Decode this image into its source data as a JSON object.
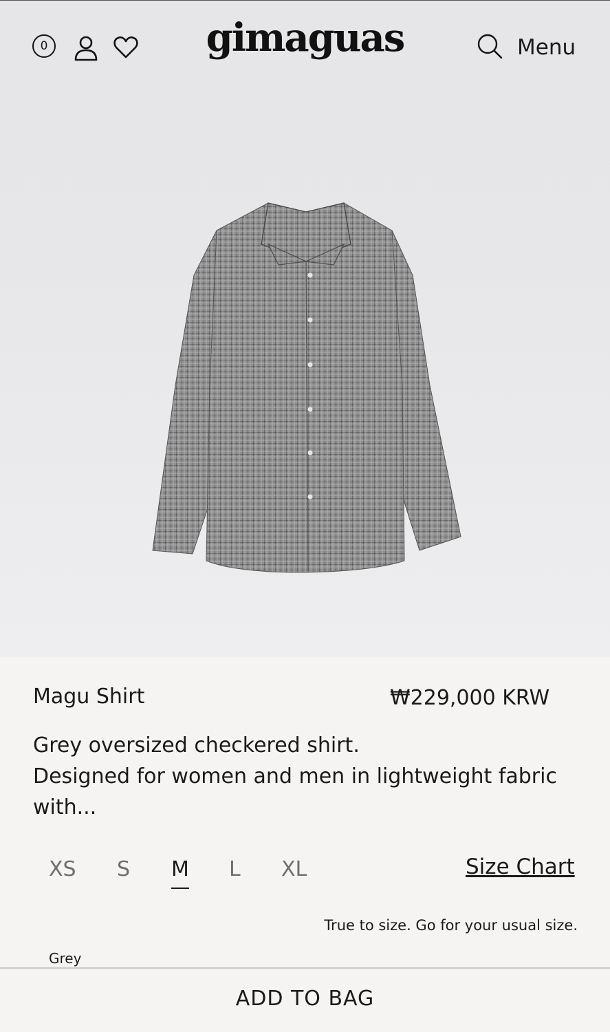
{
  "header": {
    "bag_count": "0",
    "logo": "gimaguas",
    "menu_label": "Menu"
  },
  "icons": [
    "shopping-bag-icon",
    "account-icon",
    "wishlist-heart-icon",
    "search-icon"
  ],
  "product": {
    "name": "Magu Shirt",
    "price": "₩229,000 KRW",
    "description_line1": "Grey oversized checkered shirt.",
    "description_line2": "Designed for women and men in lightweight fabric with...",
    "sizes": [
      "XS",
      "S",
      "M",
      "L",
      "XL"
    ],
    "selected_size": "M",
    "size_chart_label": "Size Chart",
    "size_note": "True to size. Go for your usual size.",
    "color": "Grey"
  },
  "cta": {
    "add_to_bag": "ADD TO BAG"
  },
  "colors": {
    "hero_bg": "#e7e7ea",
    "panel_bg": "#f6f4f2",
    "text": "#1a1a1a",
    "muted": "#6f6f6f"
  }
}
